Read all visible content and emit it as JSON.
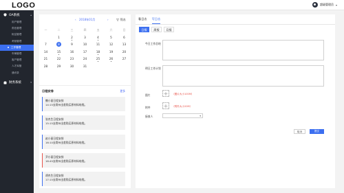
{
  "header": {
    "logo": "LOGO",
    "user_name": "超级管理员"
  },
  "sidebar": {
    "group1_label": "OA系统",
    "items": [
      {
        "label": "用户管理"
      },
      {
        "label": "角色管理"
      },
      {
        "label": "帐结管理"
      },
      {
        "label": "考勤管理"
      },
      {
        "label": "工作管理",
        "active": true
      },
      {
        "label": "车辆管理"
      },
      {
        "label": "客户管理"
      },
      {
        "label": "人才库管"
      },
      {
        "label": "通讯录"
      }
    ],
    "group2_label": "财务系统"
  },
  "calendar": {
    "prev": "‹",
    "month_label": "2018年01月",
    "next": "›",
    "filter_label": "筛选",
    "weekdays": [
      "一",
      "二",
      "三",
      "四",
      "五",
      "六",
      "日"
    ],
    "weeks": [
      [
        "",
        "1",
        "2",
        "3",
        "4",
        "5",
        "6"
      ],
      [
        "7",
        "8",
        "9",
        "10",
        "11",
        "12",
        "13"
      ],
      [
        "14",
        "15",
        "16",
        "17",
        "18",
        "19",
        "20"
      ],
      [
        "21",
        "22",
        "23",
        "24",
        "25",
        "26",
        "27"
      ],
      [
        "28",
        "29",
        "30",
        "31",
        "",
        "",
        ""
      ]
    ]
  },
  "schedule": {
    "title": "日程安排",
    "more": "更多",
    "items": [
      {
        "title": "撒小丽日程安排",
        "detail": "14:15去常州出差购买原材料电缆。"
      },
      {
        "title": "张杰生日程安排",
        "detail": "15:15去常州出差购买原材料电缆。"
      },
      {
        "title": "赵小丽日程安排",
        "detail": "16:10去常州出差购买原材料电缆。"
      },
      {
        "title": "尹小丽日程安排",
        "detail": "16:45去常州出差购买原材料电缆。"
      },
      {
        "title": "胡杰生日程安排",
        "detail": "17:15去常州出差购买原材料电缆。"
      }
    ]
  },
  "report": {
    "tabs": [
      "看日志",
      "写日志"
    ],
    "subtabs": [
      "日报",
      "周报",
      "月报"
    ],
    "label_today": "今日工作总结",
    "label_tomorrow": "明日工作计划",
    "label_image": "图片",
    "label_attach": "附件",
    "image_hint": "（图片大小100M）",
    "attach_hint": "（附件大小20M）",
    "label_send": "接收人",
    "btn_cancel": "取消",
    "btn_save": "提交"
  },
  "colors": {
    "accent": "#3c6ff0",
    "sidebar_bg": "#22262e",
    "warning": "#e8534a"
  }
}
